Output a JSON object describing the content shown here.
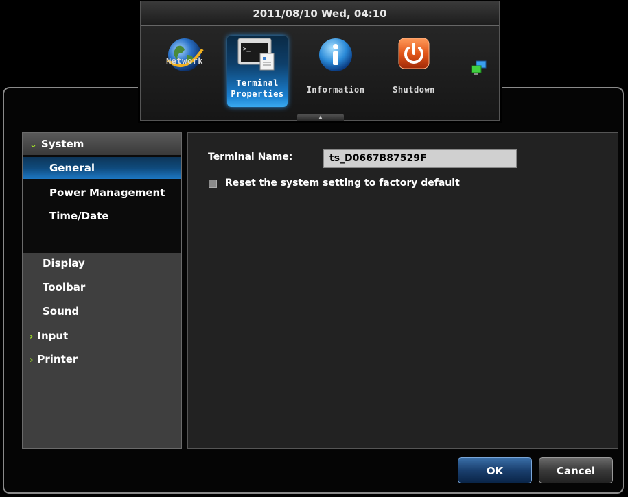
{
  "datetime": "2011/08/10 Wed, 04:10",
  "toolbar": {
    "buttons": [
      {
        "label": "Network",
        "icon": "globe-icon"
      },
      {
        "label_line1": "Terminal",
        "label_line2": "Properties",
        "icon": "terminal-icon",
        "active": true
      },
      {
        "label": "Information",
        "icon": "info-icon"
      },
      {
        "label": "Shutdown",
        "icon": "power-icon"
      }
    ],
    "network_status_icon": "network-computers-icon",
    "collapse_handle": "▲"
  },
  "sidebar": {
    "system": {
      "label": "System",
      "expanded": true
    },
    "system_items": [
      {
        "label": "General",
        "selected": true
      },
      {
        "label": "Power Management"
      },
      {
        "label": "Time/Date"
      }
    ],
    "items": [
      {
        "label": "Display"
      },
      {
        "label": "Toolbar"
      },
      {
        "label": "Sound"
      },
      {
        "label": "Input",
        "expandable": true
      },
      {
        "label": "Printer",
        "expandable": true
      }
    ]
  },
  "main": {
    "terminal_name_label": "Terminal Name:",
    "terminal_name_value": "ts_D0667B87529F",
    "reset_label": "Reset the system setting to factory default"
  },
  "buttons": {
    "ok": "OK",
    "cancel": "Cancel"
  },
  "colors": {
    "accent_blue": "#1d78c4",
    "chevron_green": "#9fdc2a"
  }
}
